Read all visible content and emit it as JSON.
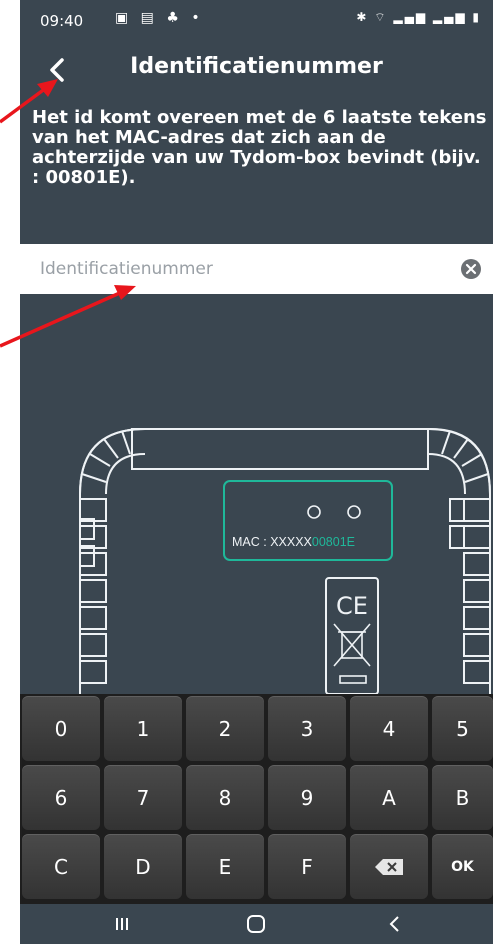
{
  "status_bar": {
    "time": "09:40"
  },
  "header": {
    "title": "Identificatienummer"
  },
  "description": "Het id komt overeen met de 6 laatste tekens van het MAC-adres dat zich aan de achterzijde van uw Tydom-box bevindt (bijv. : 00801E).",
  "input": {
    "placeholder": "Identificatienummer",
    "value": ""
  },
  "illustration": {
    "mac_prefix": "MAC : XXXXX",
    "mac_suffix": "00801E",
    "ce_mark": "CE"
  },
  "keyboard": {
    "rows": [
      [
        "0",
        "1",
        "2",
        "3",
        "4",
        "5"
      ],
      [
        "6",
        "7",
        "8",
        "9",
        "A",
        "B"
      ],
      [
        "C",
        "D",
        "E",
        "F",
        "",
        "OK"
      ]
    ]
  },
  "colors": {
    "app_bg": "#3a4650",
    "accent_green": "#1fb89a",
    "arrow_red": "#e8161c",
    "keyboard_bg": "#1e1e1e"
  }
}
